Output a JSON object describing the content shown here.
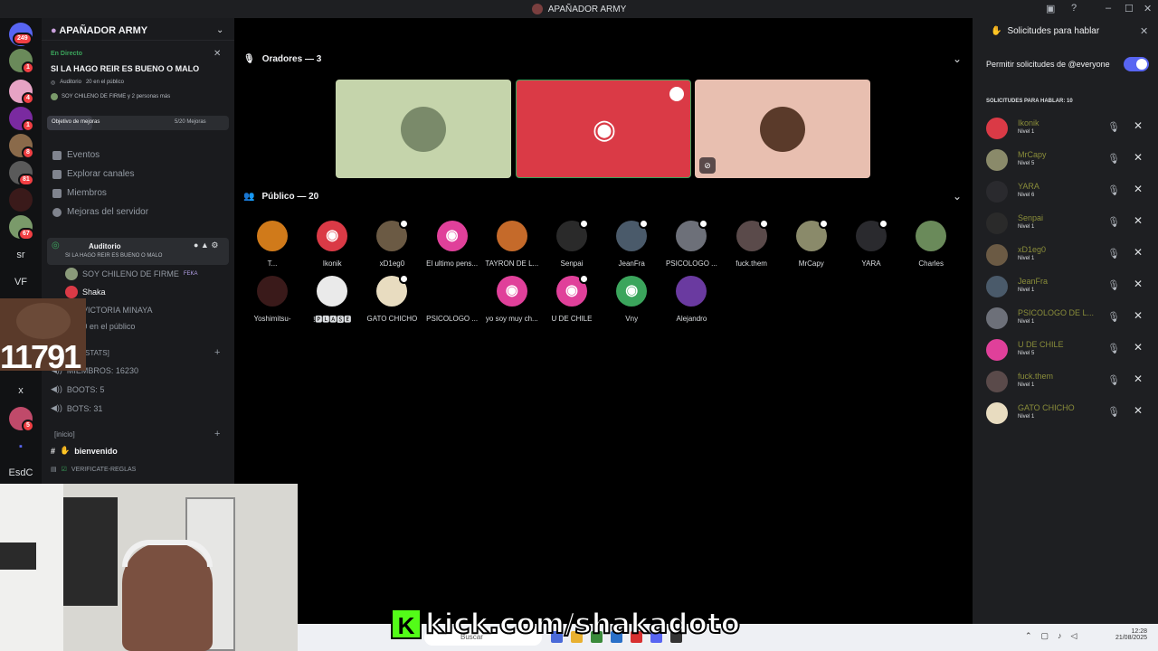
{
  "window": {
    "title": "APAÑADOR ARMY"
  },
  "rail": {
    "badges": [
      "249",
      "1",
      "4",
      "1",
      "8",
      "81",
      "67",
      "5"
    ],
    "texts": [
      "sr",
      "VF",
      "x",
      "EsdC"
    ]
  },
  "sidebar": {
    "server_name": "APAÑADOR ARMY",
    "live_label": "En Directo",
    "live_title": "SI LA HAGO REIR ES BUENO O MALO",
    "live_channel": "Auditorio",
    "live_audience": "20 en el público",
    "live_people": "SOY CHILENO DE FIRME y 2 personas más",
    "goal_label": "Objetivo de mejoras",
    "goal_value": "5/20 Mejoras",
    "nav": [
      "Eventos",
      "Explorar canales",
      "Miembros",
      "Mejoras del servidor"
    ],
    "stage_channel": "Auditorio",
    "stage_subtitle": "SI LA HAGO REIR ES BUENO O MALO",
    "stage_members": [
      {
        "name": "SOY CHILENO DE FIRME",
        "tag": "FEKA"
      },
      {
        "name": "Shaka"
      },
      {
        "name": "VICTORIA MINAYA"
      }
    ],
    "stage_audience": "20 en el público",
    "stats_category": "R STATS]",
    "stats": [
      "MIEMBROS: 16230",
      "BOOTS: 5",
      "BOTS: 31"
    ],
    "inicio_category": "[inicio]",
    "channels": [
      "bienvenido",
      "VERIFICATE-REGLAS"
    ]
  },
  "facecam_overlay": "11791",
  "stage": {
    "speakers_label": "Oradores — 3",
    "public_label": "Público — 20",
    "speaker_colors": [
      "#c5d4ab",
      "#da3a46",
      "#e8bfb0"
    ],
    "public_members": [
      {
        "name": "T...",
        "color": "#d07a1a"
      },
      {
        "name": "Ikonik",
        "color": "#da3a46"
      },
      {
        "name": "xD1eg0",
        "color": "#6b5a44"
      },
      {
        "name": "El ultimo pens...",
        "color": "#e0409a"
      },
      {
        "name": "TAYRON DE L...",
        "color": "#c56a2a"
      },
      {
        "name": "Senpai",
        "color": "#2a2a2a"
      },
      {
        "name": "JeanFra",
        "color": "#4a5a6a"
      },
      {
        "name": "PSICOLOGO ...",
        "color": "#6d7079"
      },
      {
        "name": "fuck.them",
        "color": "#5a4a4a"
      },
      {
        "name": "MrCapy",
        "color": "#8a8a6a"
      },
      {
        "name": "YARA",
        "color": "#2a2a2e"
      },
      {
        "name": "Charles",
        "color": "#6a8a5a"
      },
      {
        "name": "Yoshimitsu-",
        "color": "#3a1a1a"
      },
      {
        "name": "!🅿🅻🅰🆂🅴",
        "color": "#eaeaea"
      },
      {
        "name": "GATO CHICHO",
        "color": "#e8dcc0"
      },
      {
        "name": "PSICOLOGO ...",
        "color": "#000000"
      },
      {
        "name": "yo soy muy ch...",
        "color": "#e0409a"
      },
      {
        "name": "U DE CHILE",
        "color": "#e0409a"
      },
      {
        "name": "Vny",
        "color": "#3ba55c"
      },
      {
        "name": "Alejandro",
        "color": "#6a3aa0"
      }
    ]
  },
  "requests": {
    "header": "Solicitudes para hablar",
    "allow_label": "Permitir solicitudes de @everyone",
    "count_label": "SOLICITUDES PARA HABLAR: 10",
    "items": [
      {
        "name": "Ikonik",
        "level": "Nivel 1",
        "color": "#da3a46"
      },
      {
        "name": "MrCapy",
        "level": "Nivel 5",
        "color": "#8a8a6a"
      },
      {
        "name": "YARA",
        "level": "Nivel 6",
        "color": "#2a2a2e"
      },
      {
        "name": "Senpai",
        "level": "Nivel 1",
        "color": "#2a2a2a"
      },
      {
        "name": "xD1eg0",
        "level": "Nivel 1",
        "color": "#6b5a44"
      },
      {
        "name": "JeanFra",
        "level": "Nivel 1",
        "color": "#4a5a6a"
      },
      {
        "name": "PSICOLOGO DE L...",
        "level": "Nivel 1",
        "color": "#6d7079"
      },
      {
        "name": "U DE CHILE",
        "level": "Nivel 5",
        "color": "#e0409a"
      },
      {
        "name": "fuck.them",
        "level": "Nivel 1",
        "color": "#5a4a4a"
      },
      {
        "name": "GATO CHICHO",
        "level": "Nivel 1",
        "color": "#e8dcc0"
      }
    ]
  },
  "taskbar": {
    "search": "Buscar",
    "time": "12:28",
    "date": "21/08/2025"
  },
  "overlay": {
    "kick_url": "kick.com/shakadoto"
  }
}
